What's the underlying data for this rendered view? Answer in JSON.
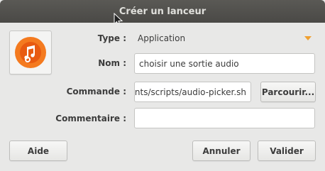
{
  "window": {
    "title": "Créer un lanceur"
  },
  "form": {
    "type_label": "Type :",
    "type_value": "Application",
    "name_label": "Nom :",
    "name_value": "choisir une sortie audio",
    "command_label": "Commande :",
    "command_value": "ents/scripts/audio-picker.sh",
    "comment_label": "Commentaire :",
    "comment_value": ""
  },
  "buttons": {
    "browse": "Parcourir...",
    "help": "Aide",
    "cancel": "Annuler",
    "ok": "Valider"
  },
  "colors": {
    "titlebar": "#4f4e4a",
    "icon_orange": "#f47a1f",
    "dropdown_arrow": "#f0a030"
  },
  "icons": [
    "music-note-icon",
    "dropdown-arrow-icon",
    "mouse-cursor-icon"
  ]
}
